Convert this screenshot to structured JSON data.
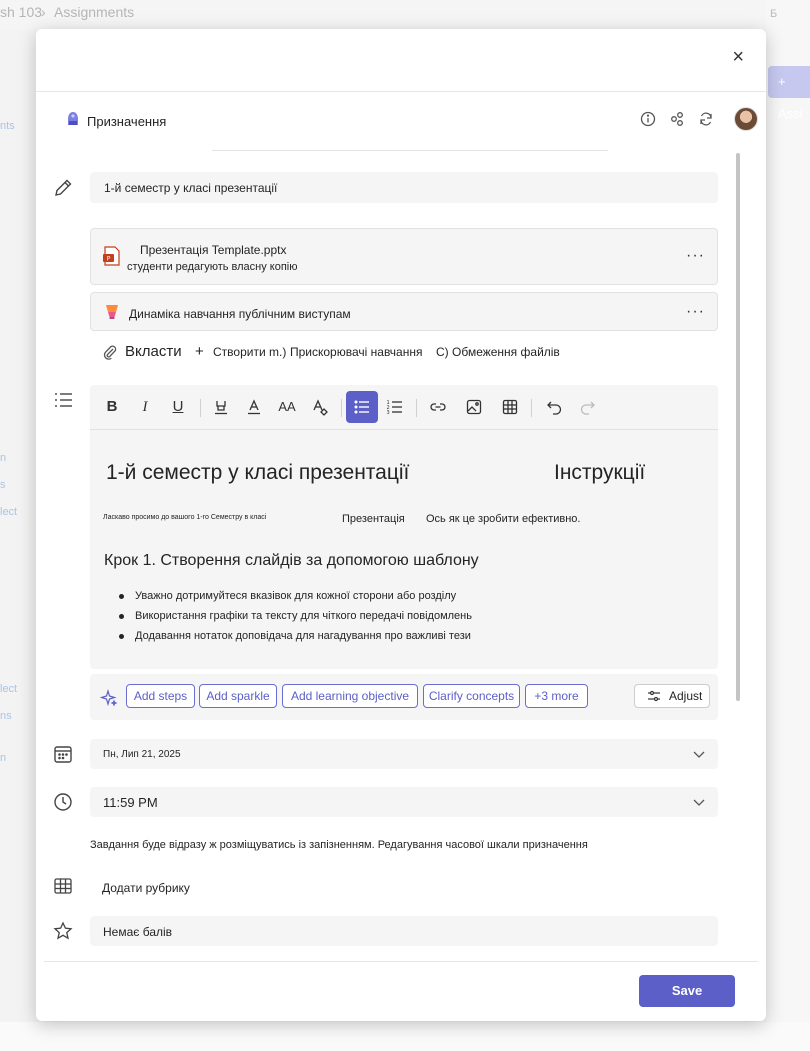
{
  "background": {
    "breadcrumb_course": "sh 103",
    "breadcrumb_sep": "›",
    "breadcrumb_page": "Assignments",
    "top_right": "Б",
    "assign_button": "+ Assi",
    "left_labels": [
      "nts",
      "n",
      "s",
      "lect",
      "lect",
      "ns",
      "n"
    ]
  },
  "dialog": {
    "close_label": "×",
    "app_title": "Призначення",
    "title_value": "1-й семестр у класі презентації",
    "attachments": [
      {
        "name": "Презентація Template.pptx",
        "subtitle": "студенти редагують власну копію",
        "more": "···"
      },
      {
        "name": "Динаміка навчання публічним виступам",
        "more": "···"
      }
    ],
    "attach_row": {
      "attach_label": "Вкласти",
      "create_label": "+",
      "create_text": "Створити m.)",
      "accelerators": "Прискорювачі навчання",
      "restrictions": "С) Обмеження файлів"
    },
    "editor": {
      "heading_left": "1-й семестр у класі презентації",
      "heading_right": "Інструкції",
      "small_text": "Ласкаво просимо до вашого 1-го Семестру в класі",
      "mid_text_1": "Презентація",
      "mid_text_2": "Ось як це зробити ефективно.",
      "step_heading": "Крок 1. Створення слайдів за допомогою шаблону",
      "bullets": [
        "Уважно дотримуйтеся вказівок для кожної сторони або розділу",
        "Використання графіки та тексту для чіткого передачі повідомлень",
        "Додавання нотаток доповідача для нагадування про важливі тези"
      ]
    },
    "suggestions": {
      "chips": [
        "Add steps",
        "Add sparkle",
        "Add learning objective",
        "Clarify concepts",
        "+3 more"
      ],
      "adjust_label": "Adjust"
    },
    "due_date": "Пн, Лип 21, 2025",
    "due_time": "11:59 PM",
    "schedule_note": "Завдання буде відразу ж розміщуватись із запізненням. Редагування часової шкали призначення",
    "rubric_label": "Додати рубрику",
    "points_value": "Немає балів",
    "save_label": "Save"
  },
  "colors": {
    "accent": "#5b5fc7",
    "field_bg": "#f5f5f5",
    "ppt": "#c43e1c"
  }
}
